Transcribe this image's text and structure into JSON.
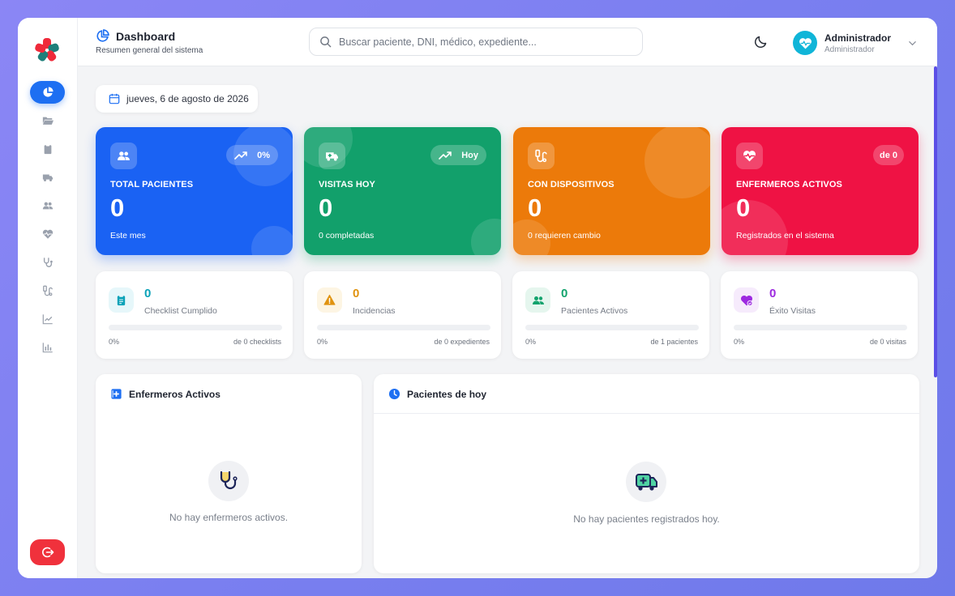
{
  "header": {
    "title": "Dashboard",
    "subtitle": "Resumen general del sistema",
    "search_placeholder": "Buscar paciente, DNI, médico, expediente...",
    "user_name": "Administrador",
    "user_role": "Administrador"
  },
  "date": "jueves, 6 de agosto de 2026",
  "sidebar": {
    "items": [
      "chart-pie-icon",
      "folder-open-icon",
      "clipboard-icon",
      "ambulance-icon",
      "users-icon",
      "heart-pulse-icon",
      "stethoscope-icon",
      "iv-device-icon",
      "trend-up-icon",
      "bar-chart-icon"
    ],
    "logout": "logout-icon"
  },
  "stats": [
    {
      "label": "TOTAL PACIENTES",
      "value": "0",
      "footer": "Este mes",
      "badge": "0%",
      "color": "#1a62f3",
      "icon": "users-icon"
    },
    {
      "label": "VISITAS HOY",
      "value": "0",
      "footer": "0 completadas",
      "badge": "Hoy",
      "color": "#12a06b",
      "icon": "ambulance-icon"
    },
    {
      "label": "CON DISPOSITIVOS",
      "value": "0",
      "footer": "0 requieren cambio",
      "badge": "",
      "color": "#ec7a0a",
      "icon": "iv-device-icon"
    },
    {
      "label": "ENFERMEROS ACTIVOS",
      "value": "0",
      "footer": "Registrados en el sistema",
      "badge": "de 0",
      "color": "#ef1244",
      "icon": "heart-pulse-icon"
    }
  ],
  "metrics": [
    {
      "value": "0",
      "label": "Checklist Cumplido",
      "percent": "0%",
      "of": "de 0 checklists",
      "color": "#0aa2b8",
      "progress": 0
    },
    {
      "value": "0",
      "label": "Incidencias",
      "percent": "0%",
      "of": "de 0 expedientes",
      "color": "#e09310",
      "progress": 0
    },
    {
      "value": "0",
      "label": "Pacientes Activos",
      "percent": "0%",
      "of": "de 1 pacientes",
      "color": "#13a36d",
      "progress": 0
    },
    {
      "value": "0",
      "label": "Éxito Visitas",
      "percent": "0%",
      "of": "de 0 visitas",
      "color": "#9d2ae0",
      "progress": 0
    }
  ],
  "panels": {
    "nurses": {
      "title": "Enfermeros Activos",
      "empty": "No hay enfermeros activos."
    },
    "patients": {
      "title": "Pacientes de hoy",
      "empty": "No hay pacientes registrados hoy."
    }
  },
  "colors": {
    "accent": "#1d6ff2",
    "logout": "#f0313c",
    "scroll": "#5b4ee6"
  }
}
